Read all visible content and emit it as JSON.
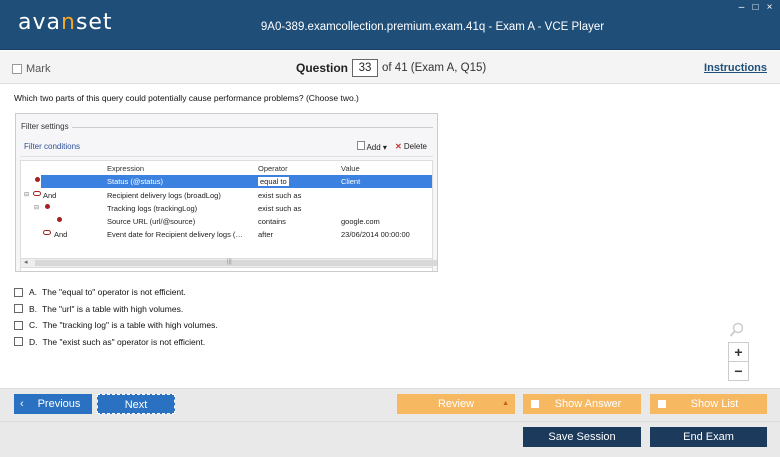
{
  "app": {
    "logo_left": "ava",
    "logo_accent": "n",
    "logo_right": "set",
    "window_title": "9A0-389.examcollection.premium.exam.41q - Exam A - VCE Player",
    "window_controls": [
      "–",
      "□",
      "×"
    ]
  },
  "toolbar": {
    "mark_label": "Mark",
    "question_label": "Question",
    "question_number": "33",
    "question_of": "of 41 (Exam A, Q15)",
    "instructions_label": "Instructions"
  },
  "question": {
    "text": "Which two parts of this query could potentially cause performance problems? (Choose two.)"
  },
  "filter_settings": {
    "title": "Filter settings",
    "conditions_title": "Filter conditions",
    "add_label": "Add ▾",
    "delete_label": "Delete",
    "columns": [
      "Expression",
      "Operator",
      "Value"
    ],
    "rows": [
      {
        "tree": "",
        "icon": "dot",
        "and": "",
        "expression": "Status (@status)",
        "operator": "equal to",
        "value": "Client"
      },
      {
        "tree": "⊟",
        "icon": "and",
        "and": "And",
        "expression": "Recipient delivery logs (broadLog)",
        "operator": "exist such as",
        "value": ""
      },
      {
        "tree": "⊟",
        "icon": "dot",
        "and": "",
        "expression": "Tracking logs (trackingLog)",
        "operator": "exist such as",
        "value": ""
      },
      {
        "tree": "",
        "icon": "dot",
        "and": "",
        "expression": "Source URL (url/@source)",
        "operator": "contains",
        "value": "google.com"
      },
      {
        "tree": "",
        "icon": "and",
        "and": "And",
        "expression": "Event date for Recipient delivery logs (…",
        "operator": "after",
        "value": "23/06/2014 00:00:00"
      }
    ]
  },
  "answers": [
    {
      "letter": "A.",
      "text": "The \"equal to\" operator is not efficient."
    },
    {
      "letter": "B.",
      "text": "The \"url\" is a table with high volumes."
    },
    {
      "letter": "C.",
      "text": "The \"tracking log\" is a table with high volumes."
    },
    {
      "letter": "D.",
      "text": "The \"exist such as\" operator is not efficient."
    }
  ],
  "zoom": {
    "plus": "+",
    "minus": "−"
  },
  "nav": {
    "previous_label": "Previous",
    "next_label": "Next",
    "review_label": "Review",
    "show_answer_label": "Show Answer",
    "show_list_label": "Show List",
    "save_session_label": "Save Session",
    "end_exam_label": "End Exam"
  },
  "colors": {
    "header": "#1f4e79",
    "accent": "#f5a623",
    "button_blue": "#2a71c2",
    "button_orange": "#f7b862",
    "button_dark": "#1b3a5c"
  }
}
